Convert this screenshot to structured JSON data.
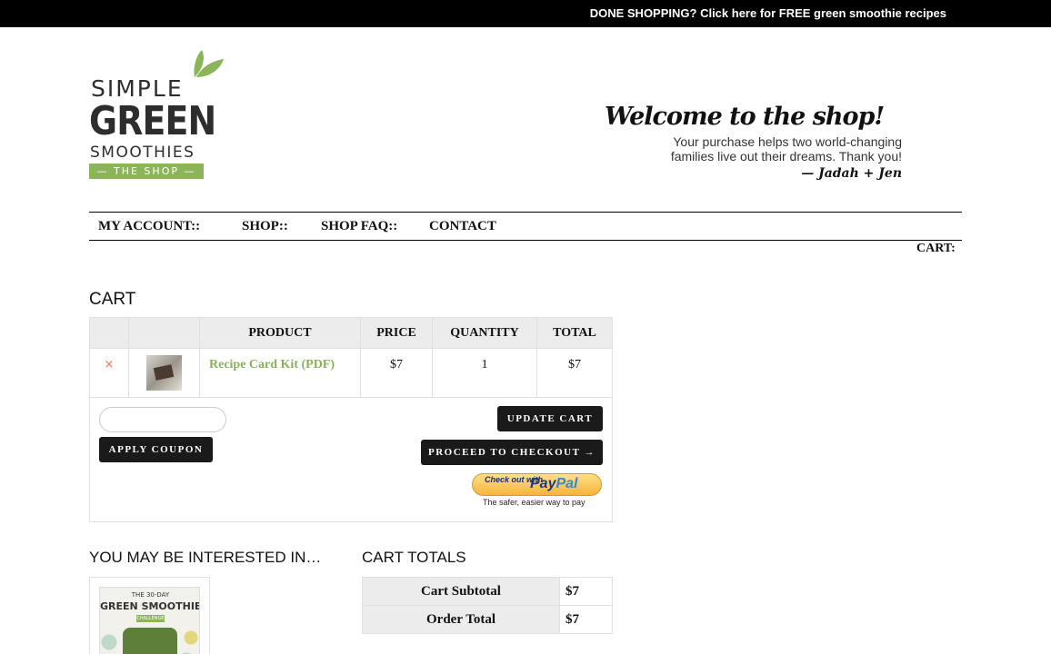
{
  "topbar": {
    "link_text": "DONE SHOPPING? Click here for FREE green smoothie recipes"
  },
  "logo": {
    "line1": "SIMPLE",
    "line2": "GREEN",
    "line3": "SMOOTHIES",
    "line4": "— THE SHOP —",
    "leaf_color": "#8cb55a"
  },
  "welcome": {
    "title": "Welcome to the shop!",
    "line1": "Your purchase helps two world-changing",
    "line2": "families live out their dreams. Thank you!",
    "signature": "— Jadah + Jen"
  },
  "nav": {
    "items": [
      "MY ACCOUNT::",
      "SHOP::",
      "SHOP FAQ::",
      "CONTACT"
    ],
    "cart_label": "CART:"
  },
  "cart": {
    "heading": "CART",
    "columns": [
      "",
      "",
      "PRODUCT",
      "PRICE",
      "QUANTITY",
      "TOTAL"
    ],
    "rows": [
      {
        "remove_icon": "×",
        "product": "Recipe Card Kit (PDF)",
        "price": "$7",
        "quantity": "1",
        "total": "$7"
      }
    ],
    "coupon_placeholder": "",
    "apply_coupon_label": "APPLY COUPON",
    "update_cart_label": "UPDATE CART",
    "checkout_label": "PROCEED TO CHECKOUT →",
    "paypal": {
      "checkout_text": "Check out with",
      "brand_pay": "Pay",
      "brand_pal": "Pal",
      "tagline": "The safer, easier way to pay"
    }
  },
  "interest": {
    "heading": "YOU MAY BE INTERESTED IN…",
    "product": {
      "line1": "THE 30-DAY",
      "line2": "GREEN SMOOTHIE",
      "line3": "CHALLENGE"
    }
  },
  "totals": {
    "heading": "CART TOTALS",
    "rows": [
      {
        "label": "Cart Subtotal",
        "value": "$7"
      },
      {
        "label": "Order Total",
        "value": "$7"
      }
    ]
  },
  "colors": {
    "accent_green": "#8ab15a",
    "button_dark": "#1a1a1a",
    "topbar": "#000000"
  }
}
